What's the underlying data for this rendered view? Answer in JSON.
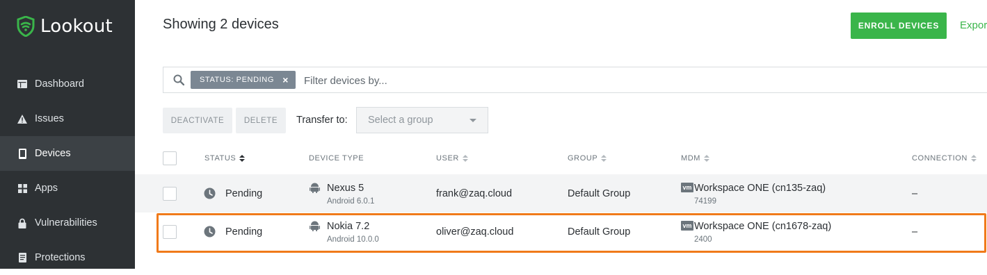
{
  "app": {
    "name": "Lookout",
    "accent_color": "#3ab54a",
    "sidebar_color": "#2d3134",
    "highlight_color": "#f07a1a"
  },
  "sidebar": {
    "items": [
      {
        "label": "Dashboard",
        "icon": "dashboard-icon",
        "active": false
      },
      {
        "label": "Issues",
        "icon": "warning-icon",
        "active": false
      },
      {
        "label": "Devices",
        "icon": "device-icon",
        "active": true
      },
      {
        "label": "Apps",
        "icon": "apps-grid-icon",
        "active": false
      },
      {
        "label": "Vulnerabilities",
        "icon": "lock-icon",
        "active": false
      },
      {
        "label": "Protections",
        "icon": "document-icon",
        "active": false
      }
    ]
  },
  "header": {
    "title": "Showing 2 devices",
    "enroll_label": "ENROLL DEVICES",
    "export_label": "Expor"
  },
  "filter": {
    "chip_label": "STATUS: PENDING",
    "chip_close": "×",
    "placeholder": "Filter devices by..."
  },
  "actions": {
    "deactivate_label": "DEACTIVATE",
    "delete_label": "DELETE",
    "transfer_label": "Transfer to:",
    "group_select_value": "Select a group"
  },
  "table": {
    "columns": [
      "STATUS",
      "DEVICE TYPE",
      "USER",
      "GROUP",
      "MDM",
      "CONNECTION"
    ],
    "rows": [
      {
        "status": "Pending",
        "device": "Nexus 5",
        "os": "Android 6.0.1",
        "user": "frank@zaq.cloud",
        "group": "Default Group",
        "mdm_badge": "vm",
        "mdm": "Workspace ONE (cn135-zaq)",
        "mdm_id": "74199",
        "connection": "–"
      },
      {
        "status": "Pending",
        "device": "Nokia 7.2",
        "os": "Android 10.0.0",
        "user": "oliver@zaq.cloud",
        "group": "Default Group",
        "mdm_badge": "vm",
        "mdm": "Workspace ONE (cn1678-zaq)",
        "mdm_id": "2400",
        "connection": "–"
      }
    ]
  }
}
